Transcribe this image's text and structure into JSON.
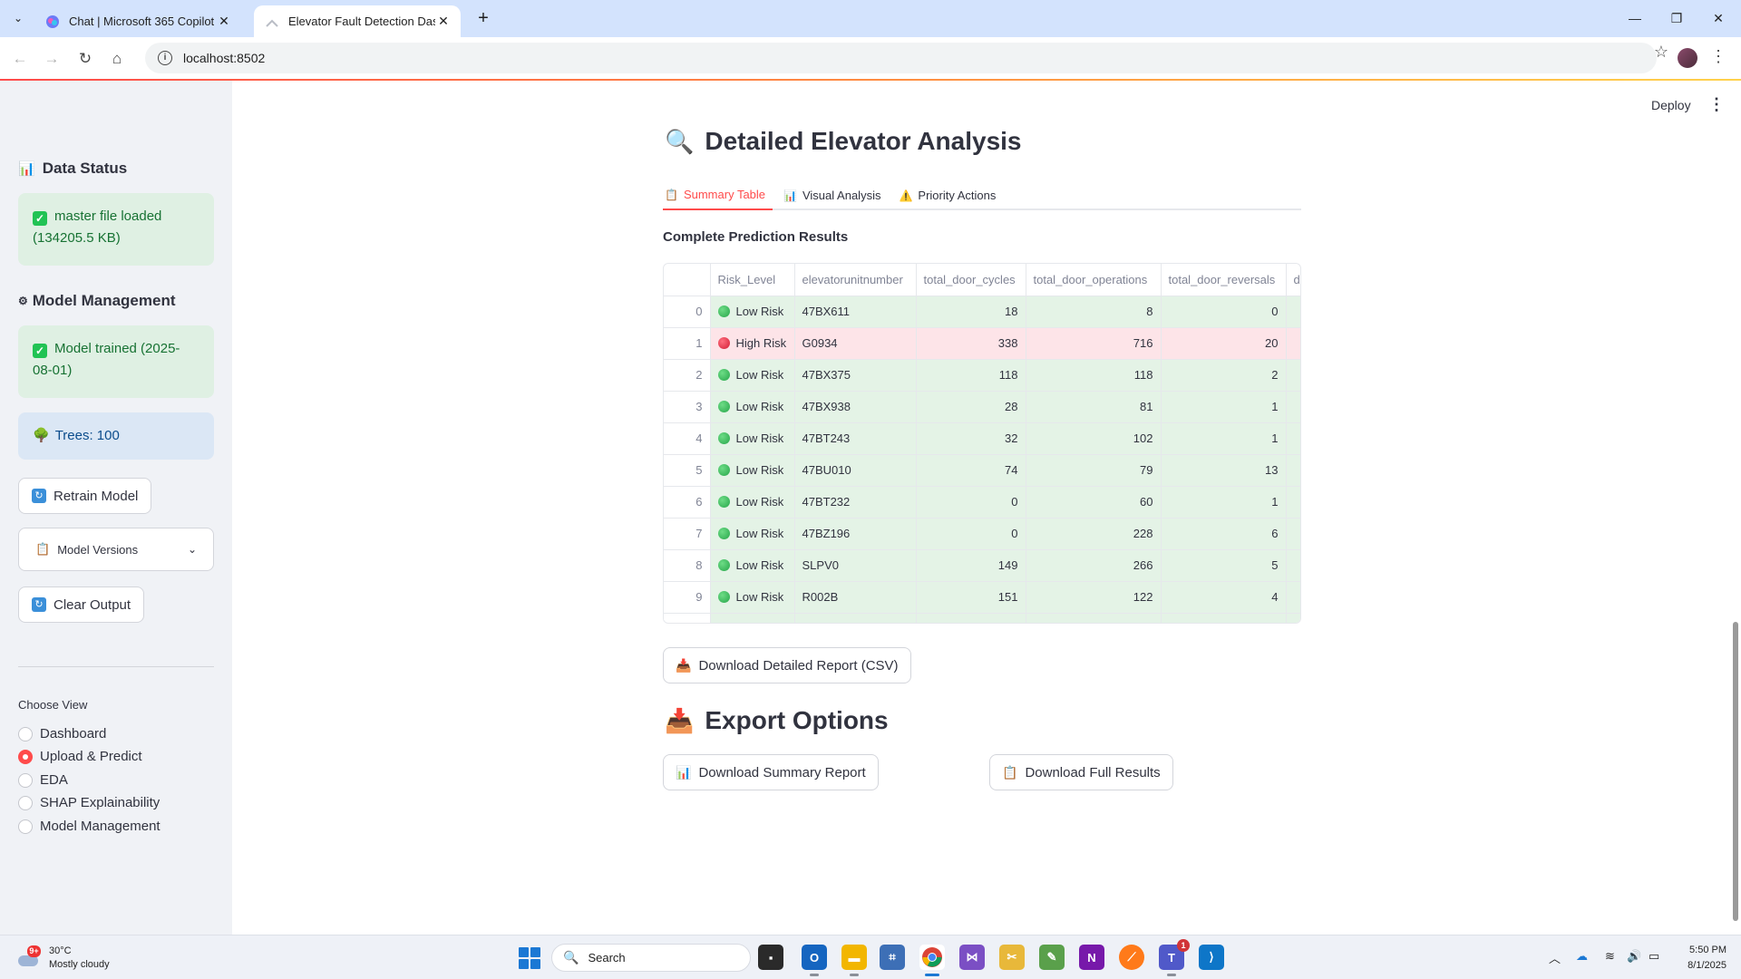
{
  "browser": {
    "tabs": [
      {
        "title": "Chat | Microsoft 365 Copilot",
        "active": false
      },
      {
        "title": "Elevator Fault Detection Dashbo",
        "active": true
      }
    ],
    "url": "localhost:8502"
  },
  "sidebar": {
    "data_status_title": "Data Status",
    "data_status_msg": "master file loaded (134205.5 KB)",
    "model_mgmt_title": "Model Management",
    "model_trained_msg": "Model trained (2025-08-01)",
    "trees_msg": "Trees: 100",
    "retrain_label": "Retrain Model",
    "model_versions_label": "Model Versions",
    "clear_output_label": "Clear Output",
    "choose_view_label": "Choose View",
    "views": [
      {
        "label": "Dashboard",
        "selected": false
      },
      {
        "label": "Upload & Predict",
        "selected": true
      },
      {
        "label": "EDA",
        "selected": false
      },
      {
        "label": "SHAP Explainability",
        "selected": false
      },
      {
        "label": "Model Management",
        "selected": false
      }
    ]
  },
  "header": {
    "deploy_label": "Deploy"
  },
  "main": {
    "analysis_title": "Detailed Elevator Analysis",
    "tabs": [
      {
        "label": "Summary Table",
        "icon": "clipboard-icon"
      },
      {
        "label": "Visual Analysis",
        "icon": "bar-chart-icon"
      },
      {
        "label": "Priority Actions",
        "icon": "warning-icon"
      }
    ],
    "results_title": "Complete Prediction Results",
    "table": {
      "columns": [
        "Risk_Level",
        "elevatorunitnumber",
        "total_door_cycles",
        "total_door_operations",
        "total_door_reversals",
        "d"
      ],
      "rows": [
        {
          "idx": "0",
          "risk": "Low Risk",
          "unit": "47BX611",
          "cycles": "18",
          "ops": "8",
          "rev": "0"
        },
        {
          "idx": "1",
          "risk": "High Risk",
          "unit": "G0934",
          "cycles": "338",
          "ops": "716",
          "rev": "20"
        },
        {
          "idx": "2",
          "risk": "Low Risk",
          "unit": "47BX375",
          "cycles": "118",
          "ops": "118",
          "rev": "2"
        },
        {
          "idx": "3",
          "risk": "Low Risk",
          "unit": "47BX938",
          "cycles": "28",
          "ops": "81",
          "rev": "1"
        },
        {
          "idx": "4",
          "risk": "Low Risk",
          "unit": "47BT243",
          "cycles": "32",
          "ops": "102",
          "rev": "1"
        },
        {
          "idx": "5",
          "risk": "Low Risk",
          "unit": "47BU010",
          "cycles": "74",
          "ops": "79",
          "rev": "13"
        },
        {
          "idx": "6",
          "risk": "Low Risk",
          "unit": "47BT232",
          "cycles": "0",
          "ops": "60",
          "rev": "1"
        },
        {
          "idx": "7",
          "risk": "Low Risk",
          "unit": "47BZ196",
          "cycles": "0",
          "ops": "228",
          "rev": "6"
        },
        {
          "idx": "8",
          "risk": "Low Risk",
          "unit": "SLPV0",
          "cycles": "149",
          "ops": "266",
          "rev": "5"
        },
        {
          "idx": "9",
          "risk": "Low Risk",
          "unit": "R002B",
          "cycles": "151",
          "ops": "122",
          "rev": "4"
        }
      ]
    },
    "download_detailed_label": "Download Detailed Report (CSV)",
    "export_title": "Export Options",
    "download_summary_label": "Download Summary Report",
    "download_full_label": "Download Full Results"
  },
  "taskbar": {
    "temperature": "30°C",
    "weather": "Mostly cloudy",
    "weather_badge": "9+",
    "search_placeholder": "Search",
    "teams_badge": "1",
    "time": "5:50 PM",
    "date": "8/1/2025"
  },
  "colors": {
    "accent": "#ff4b4b",
    "success_bg": "#dff0e3",
    "info_bg": "#dbe7f5",
    "low_row": "#e4f3e6",
    "high_row": "#fde4e8"
  }
}
